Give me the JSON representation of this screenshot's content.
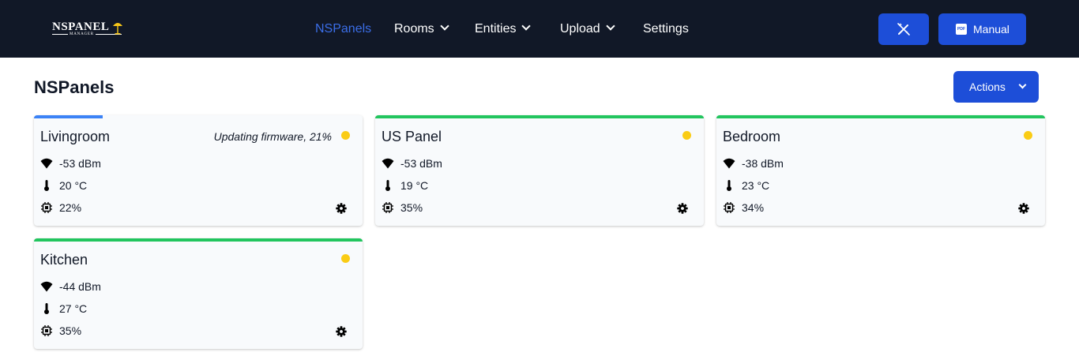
{
  "app": {
    "logo_text": "NSPANEL",
    "logo_subtext": "MANAGER"
  },
  "nav": {
    "items": [
      {
        "label": "NSPanels",
        "active": true
      },
      {
        "label": "Rooms",
        "dropdown": true
      },
      {
        "label": "Entities",
        "dropdown": true
      },
      {
        "label": "Upload",
        "dropdown": true
      },
      {
        "label": "Settings"
      }
    ],
    "manual_label": "Manual",
    "manual_icon_text": "PDF"
  },
  "page": {
    "title": "NSPanels",
    "actions_label": "Actions"
  },
  "colors": {
    "navbar": "#111827",
    "accent": "#1d4ed8",
    "online": "#22c55e",
    "updating": "#3b82f6",
    "status_dot": "#facc15"
  },
  "panels": [
    {
      "name": "Livingroom",
      "status": "Updating firmware, 21%",
      "update_progress": 0.21,
      "wifi": "-53 dBm",
      "temperature": "20 °C",
      "cpu": "22%"
    },
    {
      "name": "US Panel",
      "status": "",
      "wifi": "-53 dBm",
      "temperature": "19 °C",
      "cpu": "35%"
    },
    {
      "name": "Bedroom",
      "status": "",
      "wifi": "-38 dBm",
      "temperature": "23 °C",
      "cpu": "34%"
    },
    {
      "name": "Kitchen",
      "status": "",
      "wifi": "-44 dBm",
      "temperature": "27 °C",
      "cpu": "35%"
    }
  ]
}
